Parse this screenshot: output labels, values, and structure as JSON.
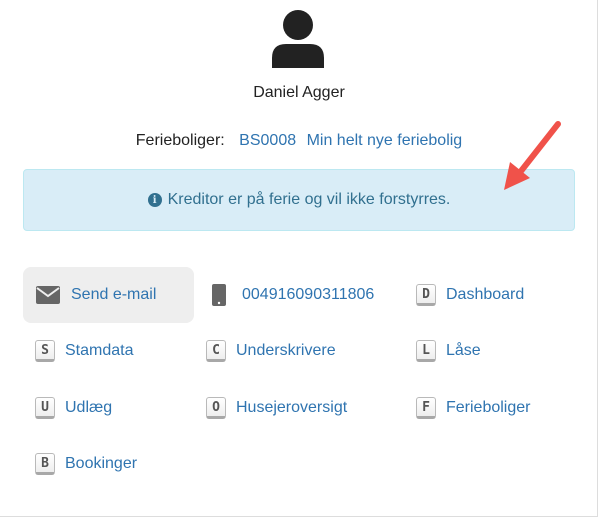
{
  "user": {
    "name": "Daniel Agger"
  },
  "properties": {
    "label": "Ferieboliger:",
    "code": "BS0008",
    "title": "Min helt nye feriebolig"
  },
  "alert": {
    "text": "Kreditor er på ferie og vil ikke forstyrres."
  },
  "actions": {
    "send_email": {
      "label": "Send e-mail",
      "icon": "envelope-icon"
    },
    "phone": {
      "label": "004916090311806",
      "icon": "phone-icon"
    },
    "dashboard": {
      "key": "D",
      "label": "Dashboard"
    },
    "stamdata": {
      "key": "S",
      "label": "Stamdata"
    },
    "underskrivere": {
      "key": "C",
      "label": "Underskrivere"
    },
    "laase": {
      "key": "L",
      "label": "Låse"
    },
    "udlaeg": {
      "key": "U",
      "label": "Udlæg"
    },
    "husejeroversigt": {
      "key": "O",
      "label": "Husejeroversigt"
    },
    "ferieboliger": {
      "key": "F",
      "label": "Ferieboliger"
    },
    "bookinger": {
      "key": "B",
      "label": "Bookinger"
    }
  },
  "colors": {
    "link": "#2f74b0",
    "alert_bg": "#d9edf7",
    "alert_text": "#31708f",
    "arrow": "#f0524a"
  }
}
